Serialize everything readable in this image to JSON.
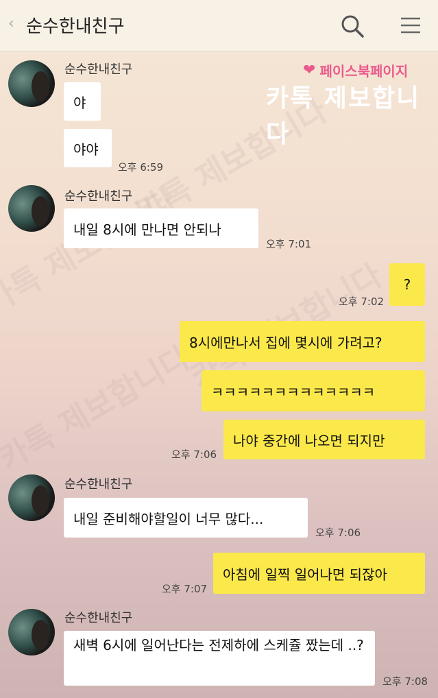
{
  "header": {
    "back_glyph": "‹",
    "title": "순수한내친구"
  },
  "watermark": {
    "badge_label": "페이스북페이지",
    "badge_sub": "카톡 제보합니다",
    "background_text": "카톡 제보합니다"
  },
  "messages": [
    {
      "id": 1,
      "sender": "순수한내친구",
      "text": "야",
      "direction": "in"
    },
    {
      "id": 2,
      "text": "야야",
      "time": "오후 6:59",
      "direction": "in"
    },
    {
      "id": 3,
      "sender": "순수한내친구",
      "text": "내일 8시에 만나면 안되나",
      "time": "오후 7:01",
      "direction": "in"
    },
    {
      "id": 4,
      "text": "?",
      "time": "오후 7:02",
      "direction": "out"
    },
    {
      "id": 5,
      "text": "8시에만나서 집에 몇시에 가려고?",
      "direction": "out"
    },
    {
      "id": 6,
      "text": "ㅋㅋㅋㅋㅋㅋㅋㅋㅋㅋㅋㅋㅋ",
      "direction": "out"
    },
    {
      "id": 7,
      "text": "나야 중간에 나오면 되지만",
      "time": "오후 7:06",
      "direction": "out"
    },
    {
      "id": 8,
      "sender": "순수한내친구",
      "text": "내일 준비해야할일이 너무 많다...",
      "time": "오후 7:06",
      "direction": "in"
    },
    {
      "id": 9,
      "text": "아침에 일찍 일어나면 되잖아",
      "time": "오후 7:07",
      "direction": "out"
    },
    {
      "id": 10,
      "sender": "순수한내친구",
      "text": "새벽 6시에 일어난다는 전제하에 스케쥴 짰는데 ..?",
      "time": "오후 7:08",
      "direction": "in"
    }
  ]
}
